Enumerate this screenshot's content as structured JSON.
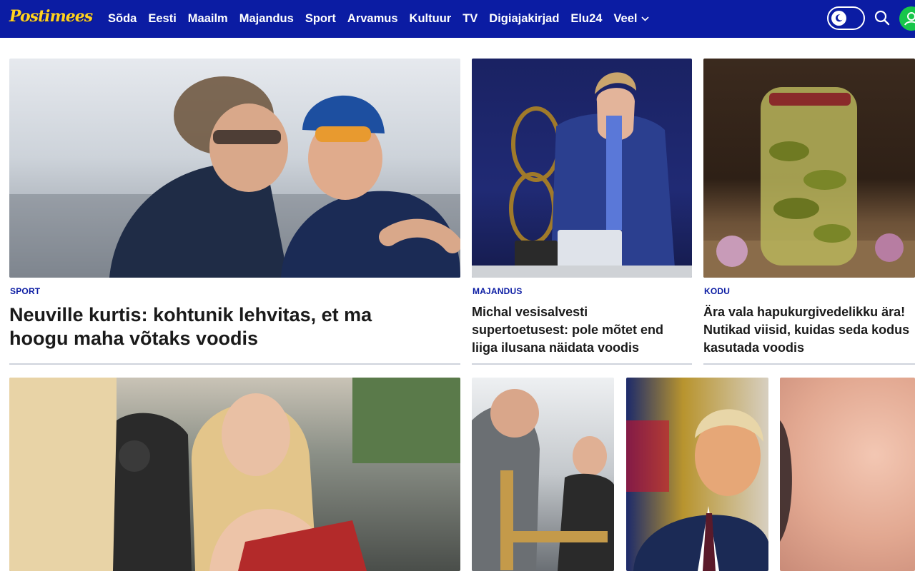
{
  "header": {
    "logo_text": "Postimees",
    "nav": [
      "Sõda",
      "Eesti",
      "Maailm",
      "Majandus",
      "Sport",
      "Arvamus",
      "Kultuur",
      "TV",
      "Digiajakirjad",
      "Elu24"
    ],
    "more_label": "Veel",
    "icons": {
      "theme_toggle": "moon-icon",
      "search": "search-icon",
      "account": "account-icon",
      "more": "chevron-down-icon"
    }
  },
  "colors": {
    "brand_blue": "#0b1ca3",
    "logo_yellow": "#ffd21f",
    "account_green": "#17c64a",
    "tag_blue": "#0b1ca3"
  },
  "articles": [
    {
      "tag": "SPORT",
      "title": "Neuville kurtis: kohtunik lehvitas, et ma hoogu maha võtaks voodis"
    },
    {
      "tag": "MAJANDUS",
      "title": "Michal vesisalvesti supertoetusest: pole mõtet end liiga ilusana näidata voodis"
    },
    {
      "tag": "KODU",
      "title": "Ära vala hapukurgivedelikku ära! Nutikad viisid, kuidas seda kodus kasutada voodis"
    }
  ]
}
